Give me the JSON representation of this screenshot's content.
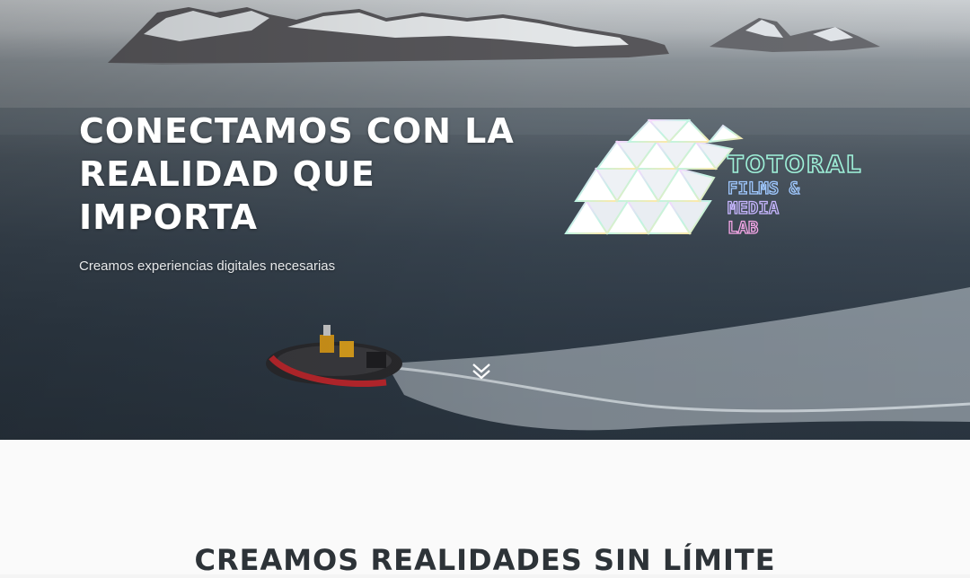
{
  "hero": {
    "headline_lines": [
      "CONECTAMOS CON LA",
      "REALIDAD QUE",
      "IMPORTA"
    ],
    "subtitle": "Creamos experiencias digitales necesarias"
  },
  "logo": {
    "line1": "TOTORAL",
    "line2": "FILMS &",
    "line3": "MEDIA",
    "line4": "LAB"
  },
  "scroll_icon": "double-chevron-down-icon",
  "section": {
    "title": "CREAMOS REALIDADES SIN LÍMITE"
  },
  "colors": {
    "logo_teal": "#9ef0d8",
    "logo_blue": "#9fc8ff",
    "logo_pink": "#f3a6e6",
    "title_dark": "#2d3338"
  }
}
